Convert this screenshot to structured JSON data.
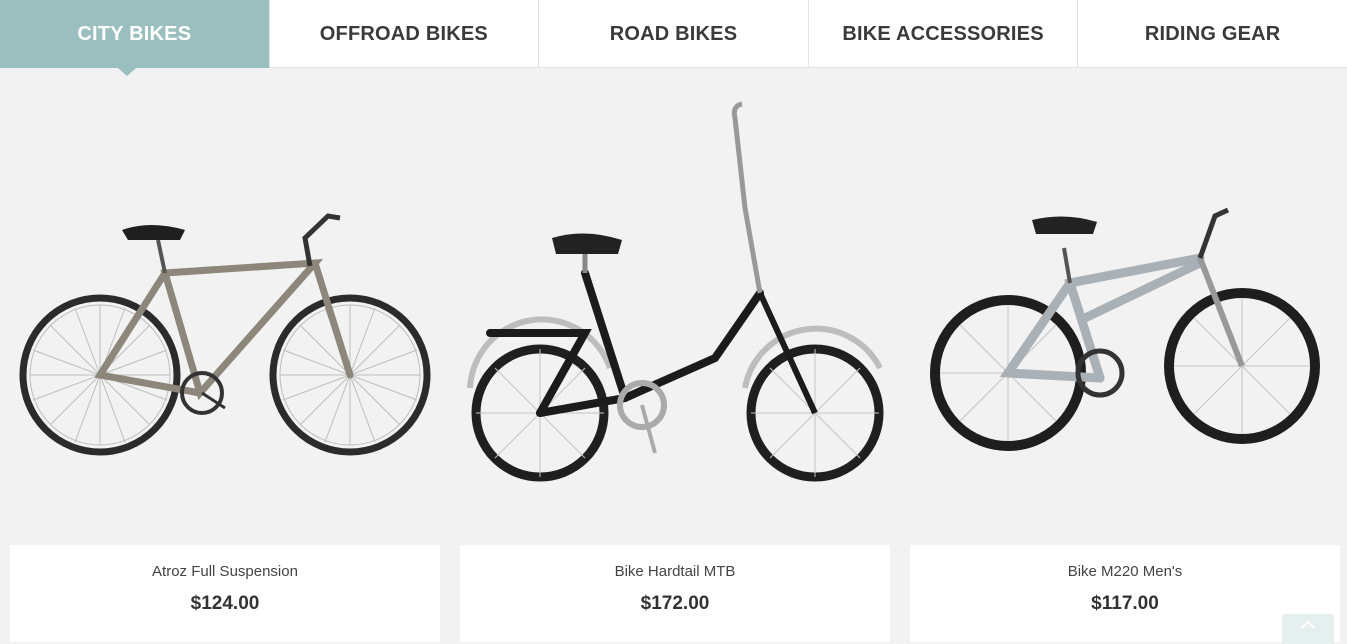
{
  "tabs": [
    {
      "label": "CITY BIKES",
      "active": true
    },
    {
      "label": "OFFROAD BIKES",
      "active": false
    },
    {
      "label": "ROAD BIKES",
      "active": false
    },
    {
      "label": "BIKE ACCESSORIES",
      "active": false
    },
    {
      "label": "RIDING GEAR",
      "active": false
    }
  ],
  "products": [
    {
      "name": "Atroz Full Suspension",
      "price": "$124.00",
      "image": "hybrid-bike-image"
    },
    {
      "name": "Bike Hardtail MTB",
      "price": "$172.00",
      "image": "folding-bike-image"
    },
    {
      "name": "Bike M220 Men's",
      "price": "$117.00",
      "image": "mountain-bike-image"
    }
  ],
  "colors": {
    "accent": "#9bbfbe",
    "background": "#f2f2f2"
  },
  "scroll_top_icon": "chevron-up-icon"
}
